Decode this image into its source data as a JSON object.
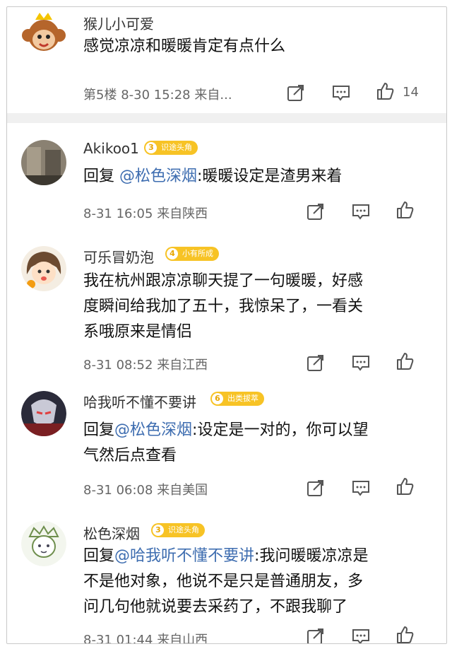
{
  "main_post": {
    "username": "猴儿小可爱",
    "text": "感觉凉凉和暖暖肯定有点什么",
    "floor": "第5楼",
    "time": "8-30 15:28",
    "source": "来自...",
    "likes": "14"
  },
  "replies": [
    {
      "username": "Akikoo1",
      "badge_level": "3",
      "badge_text": "识途头角",
      "reply_prefix": "回复 ",
      "mention": "@松色深烟",
      "text_lines": [
        ":暖暖设定是渣男来着"
      ],
      "time": "8-31 16:05",
      "source": "来自陕西"
    },
    {
      "username": "可乐冒奶泡",
      "badge_level": "4",
      "badge_text": "小有所成",
      "text_lines": [
        "我在杭州跟凉凉聊天提了一句暖暖，好感",
        "度瞬间给我加了五十，我惊呆了，一看关",
        "系哦原来是情侣"
      ],
      "time": "8-31 08:52",
      "source": "来自江西"
    },
    {
      "username": "哈我听不懂不要讲",
      "badge_level": "6",
      "badge_text": "出类拔萃",
      "reply_prefix": "回复",
      "mention": "@松色深烟",
      "text_lines": [
        ":设定是一对的，你可以望",
        "气然后点查看"
      ],
      "time": "8-31 06:08",
      "source": "来自美国"
    },
    {
      "username": "松色深烟",
      "badge_level": "3",
      "badge_text": "识途头角",
      "reply_prefix": "回复",
      "mention": "@哈我听不懂不要讲",
      "text_lines": [
        ":我问暖暖凉凉是",
        "不是他对象，他说不是只是普通朋友，多",
        "问几句他就说要去采药了，不跟我聊了"
      ],
      "time": "8-31 01:44",
      "source": "来自山西"
    }
  ],
  "icons": {
    "share": "share-icon",
    "comment": "comment-icon",
    "like": "thumbs-up-icon"
  },
  "colors": {
    "mention": "#3e6db0",
    "badge": "#f7c325",
    "meta": "#666666"
  }
}
